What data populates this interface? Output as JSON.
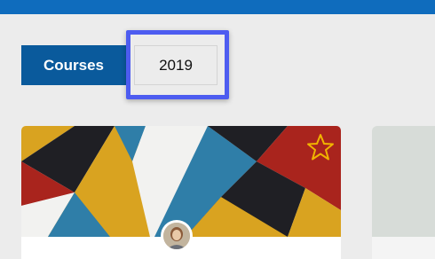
{
  "tabs": {
    "courses_label": "Courses",
    "year_label": "2019"
  },
  "card": {
    "favorite_icon": "star-outline-icon",
    "avatar": "instructor-avatar"
  },
  "colors": {
    "topbar": "#0f6cbd",
    "tab_active": "#0a5a9c",
    "focus_ring": "#4d5cf0",
    "star": "#f0b400"
  }
}
